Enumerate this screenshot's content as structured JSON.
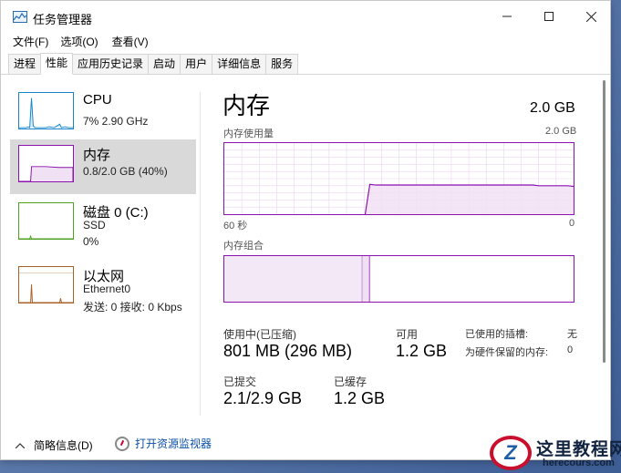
{
  "window": {
    "title": "任务管理器",
    "controls": {
      "minimize": "—",
      "maximize": "☐",
      "close": "✕"
    }
  },
  "menu": [
    "文件(F)",
    "选项(O)",
    "查看(V)"
  ],
  "tabs": [
    "进程",
    "性能",
    "应用历史记录",
    "启动",
    "用户",
    "详细信息",
    "服务"
  ],
  "active_tab": "性能",
  "resources": [
    {
      "name": "CPU",
      "line1": "7% 2.90 GHz",
      "line2": "",
      "color": "#1785c9"
    },
    {
      "name": "内存",
      "line1": "0.8/2.0 GB (40%)",
      "line2": "",
      "color": "#8b12ae",
      "selected": true
    },
    {
      "name": "磁盘 0 (C:)",
      "line1": "SSD",
      "line2": "0%",
      "color": "#4da21f"
    },
    {
      "name": "以太网",
      "line1": "Ethernet0",
      "line2": "发送: 0 接收: 0 Kbps",
      "color": "#a7622a"
    }
  ],
  "detail": {
    "title": "内存",
    "total": "2.0 GB",
    "usage_label": "内存使用量",
    "usage_max": "2.0 GB",
    "time_left": "60 秒",
    "time_right": "0",
    "composition_label": "内存组合",
    "in_use_label": "使用中(已压缩)",
    "in_use_value": "801 MB (296 MB)",
    "available_label": "可用",
    "available_value": "1.2 GB",
    "committed_label": "已提交",
    "committed_value": "2.1/2.9 GB",
    "cached_label": "已缓存",
    "cached_value": "1.2 GB",
    "slots_label": "已使用的插槽:",
    "slots_value": "无",
    "reserved_label": "为硬件保留的内存:",
    "reserved_value": "0"
  },
  "memory_usage_series": [
    0,
    0,
    0,
    0,
    0,
    0,
    0,
    0,
    0,
    0,
    0,
    0,
    0,
    0,
    0,
    0,
    0,
    0,
    0,
    0,
    0,
    0,
    0,
    0,
    0,
    0.42,
    0.41,
    0.41,
    0.41,
    0.41,
    0.41,
    0.41,
    0.41,
    0.41,
    0.41,
    0.41,
    0.41,
    0.41,
    0.41,
    0.41,
    0.41,
    0.41,
    0.41,
    0.41,
    0.41,
    0.41,
    0.41,
    0.41,
    0.41,
    0.41,
    0.41,
    0.41,
    0.41,
    0.41,
    0.4,
    0.4,
    0.4,
    0.4,
    0.4,
    0.4,
    0.39
  ],
  "bottom": {
    "fewer_details": "简略信息(D)",
    "open_monitor": "打开资源监视器"
  },
  "watermark": {
    "logo": "Z",
    "name": "这里教程网",
    "url": "herecours.com"
  },
  "colors": {
    "memory": "#8b12ae",
    "cpu": "#1785c9",
    "disk": "#4da21f",
    "ethernet": "#a7622a",
    "link": "#0b50a8"
  }
}
